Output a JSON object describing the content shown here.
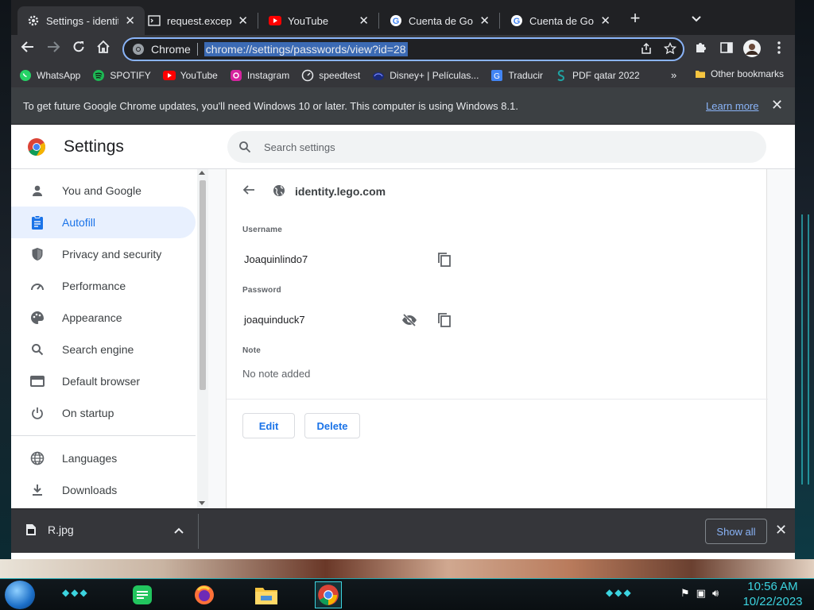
{
  "tabs": [
    {
      "title": "Settings - identit",
      "favicon": "gear-icon",
      "active": true
    },
    {
      "title": "request.exceptio",
      "favicon": "terminal-icon",
      "active": false
    },
    {
      "title": "YouTube",
      "favicon": "youtube-icon",
      "active": false
    },
    {
      "title": "Cuenta de Goog",
      "favicon": "google-icon",
      "active": false
    },
    {
      "title": "Cuenta de Goog",
      "favicon": "google-icon",
      "active": false
    }
  ],
  "omnibox": {
    "chip": "Chrome",
    "url": "chrome://settings/passwords/view?id=28"
  },
  "bookmarks": [
    {
      "label": "WhatsApp",
      "icon": "whatsapp-icon"
    },
    {
      "label": "SPOTIFY",
      "icon": "spotify-icon"
    },
    {
      "label": "YouTube",
      "icon": "youtube-icon"
    },
    {
      "label": "Instagram",
      "icon": "instagram-icon"
    },
    {
      "label": "speedtest",
      "icon": "speedtest-icon"
    },
    {
      "label": "Disney+ | Películas...",
      "icon": "disney-icon"
    },
    {
      "label": "Traducir",
      "icon": "translate-icon"
    },
    {
      "label": "PDF qatar 2022",
      "icon": "scribd-icon"
    }
  ],
  "bookmarks_more": "»",
  "other_bookmarks": "Other bookmarks",
  "infobar": {
    "message": "To get future Google Chrome updates, you'll need Windows 10 or later. This computer is using Windows 8.1.",
    "link": "Learn more"
  },
  "settings": {
    "title": "Settings",
    "search_placeholder": "Search settings"
  },
  "sidebar": {
    "items": [
      {
        "label": "You and Google",
        "icon": "person-icon"
      },
      {
        "label": "Autofill",
        "icon": "clipboard-icon",
        "active": true
      },
      {
        "label": "Privacy and security",
        "icon": "shield-icon"
      },
      {
        "label": "Performance",
        "icon": "speedometer-icon"
      },
      {
        "label": "Appearance",
        "icon": "palette-icon"
      },
      {
        "label": "Search engine",
        "icon": "search-icon"
      },
      {
        "label": "Default browser",
        "icon": "browser-icon"
      },
      {
        "label": "On startup",
        "icon": "power-icon"
      },
      {
        "label": "Languages",
        "icon": "globe-icon"
      },
      {
        "label": "Downloads",
        "icon": "download-icon"
      }
    ]
  },
  "password": {
    "site": "identity.lego.com",
    "username_label": "Username",
    "username": "Joaquinlindo7",
    "password_label": "Password",
    "password": "joaquinduck7",
    "note_label": "Note",
    "note": "No note added",
    "edit_label": "Edit",
    "delete_label": "Delete"
  },
  "downloads": {
    "file": "R.jpg",
    "show_all": "Show all"
  },
  "taskbar": {
    "time": "10:56 AM",
    "date": "10/22/2023"
  },
  "colors": {
    "accent": "#1a73e8",
    "active_bg": "#e8f0fe",
    "tab_bg": "#202124",
    "toolbar_bg": "#35363a"
  }
}
